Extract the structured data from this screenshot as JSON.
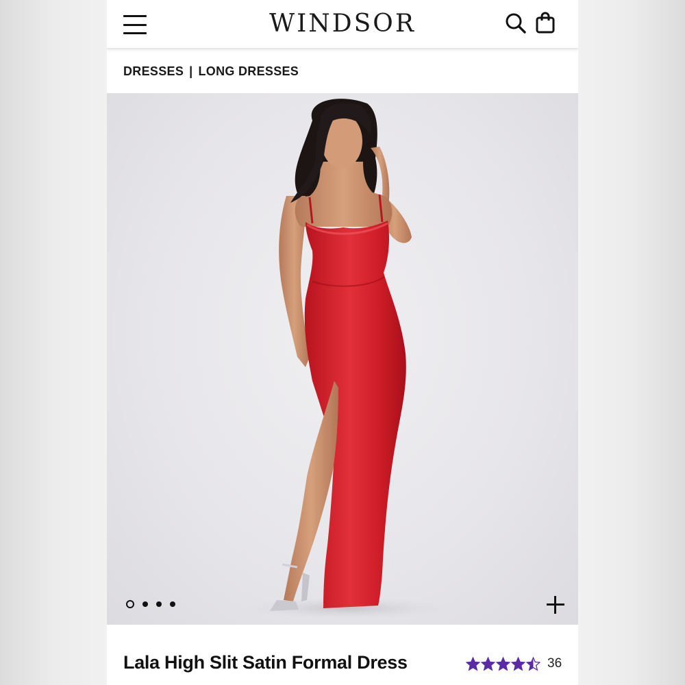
{
  "header": {
    "brand": "WINDSOR",
    "menu_icon": "hamburger-menu-icon",
    "search_icon": "search-icon",
    "bag_icon": "shopping-bag-icon"
  },
  "breadcrumb": {
    "items": [
      "DRESSES",
      "LONG DRESSES"
    ],
    "separator": "|"
  },
  "gallery": {
    "image_count": 4,
    "active_index": 0,
    "zoom_icon": "plus-icon",
    "dress_color": "#d21f2a"
  },
  "product": {
    "title": "Lala High Slit Satin Formal Dress",
    "rating": 4.5,
    "rating_max": 5,
    "review_count": "36",
    "star_color": "#5b2aa6"
  }
}
